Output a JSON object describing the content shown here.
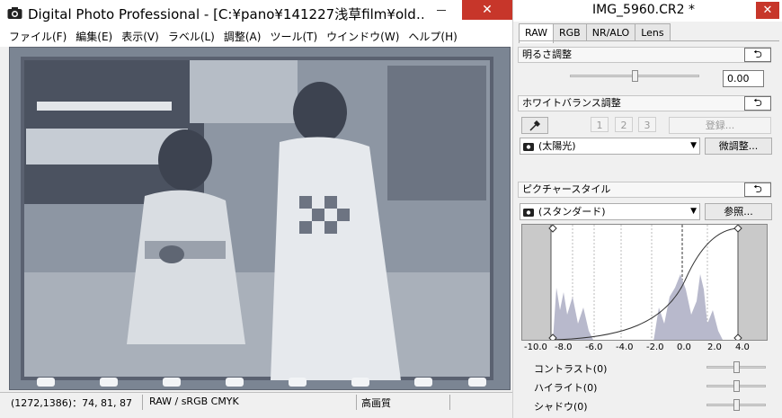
{
  "main_window": {
    "title": "Digital Photo Professional - [C:¥pano¥141227浅草film¥old…",
    "close_glyph": "✕",
    "menu": [
      "ファイル(F)",
      "編集(E)",
      "表示(V)",
      "ラベル(L)",
      "調整(A)",
      "ツール(T)",
      "ウインドウ(W)",
      "ヘルプ(H)"
    ]
  },
  "status": {
    "coords": "(1272,1386)：74, 81, 87",
    "format": "RAW / sRGB  CMYK",
    "quality": "高画質"
  },
  "palette": {
    "title": "IMG_5960.CR2 *",
    "close_glyph": "✕",
    "tabs": [
      "RAW",
      "RGB",
      "NR/ALO",
      "Lens"
    ],
    "active_tab": "RAW",
    "brightness": {
      "header": "明るさ調整",
      "value": "0.00",
      "level": 0.5
    },
    "white_balance": {
      "header": "ホワイトバランス調整",
      "presets": [
        "1",
        "2",
        "3"
      ],
      "register_label": "登録...",
      "selected": "(太陽光)",
      "fine_tune_label": "微調整..."
    },
    "picture_style": {
      "header": "ピクチャースタイル",
      "selected": "(スタンダード)",
      "browse_label": "参照...",
      "histogram_axis": [
        "-10.0",
        "-8.0",
        "-6.0",
        "-4.0",
        "-2.0",
        "0.0",
        "2.0",
        "4.0"
      ]
    },
    "adjustments": [
      {
        "label": "コントラスト(0)",
        "level": 0.5
      },
      {
        "label": "ハイライト(0)",
        "level": 0.5
      },
      {
        "label": "シャドウ(0)",
        "level": 0.5
      }
    ],
    "reset_glyph": "⮌"
  },
  "colors": {
    "close_red": "#c7362a",
    "histogram_fill": "#b8b9cc",
    "negative_bg": "#7b8593"
  }
}
